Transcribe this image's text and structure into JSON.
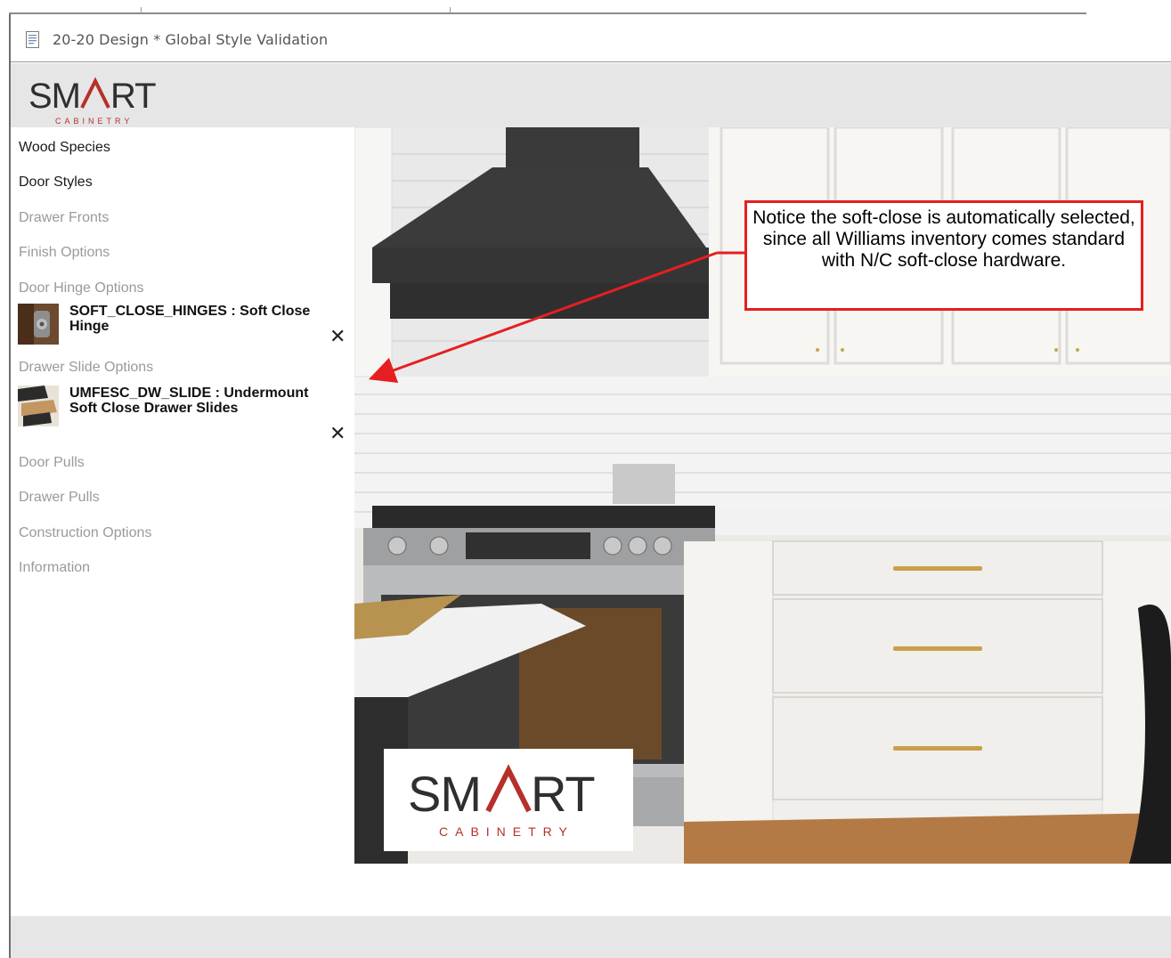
{
  "window": {
    "title": "20-20 Design * Global Style Validation"
  },
  "brand": {
    "logo_word": "SMART",
    "logo_sub": "CABINETRY",
    "accent_color": "#b5302a"
  },
  "sidebar": {
    "items": [
      {
        "label": "Wood Species",
        "state": "active"
      },
      {
        "label": "Door Styles",
        "state": "active"
      },
      {
        "label": "Drawer Fronts",
        "state": "inactive"
      },
      {
        "label": "Finish Options",
        "state": "inactive"
      },
      {
        "label": "Door Hinge Options",
        "state": "inactive"
      },
      {
        "label": "Drawer Slide Options",
        "state": "inactive"
      },
      {
        "label": "Door Pulls",
        "state": "inactive"
      },
      {
        "label": "Drawer Pulls",
        "state": "inactive"
      },
      {
        "label": "Construction Options",
        "state": "inactive"
      },
      {
        "label": "Information",
        "state": "inactive"
      }
    ],
    "selections": [
      {
        "text": "SOFT_CLOSE_HINGES : Soft Close Hinge",
        "remove_icon": "close-icon"
      },
      {
        "text": "UMFESC_DW_SLIDE : Undermount Soft Close Drawer Slides",
        "remove_icon": "close-icon"
      }
    ]
  },
  "callout": {
    "text": "Notice the soft-close is automatically selected, since all Williams inventory comes standard with N/C soft-close hardware.",
    "border_color": "#e51f1f"
  },
  "photo": {
    "overlay_logo_word": "SMART",
    "overlay_logo_sub": "CABINETRY"
  }
}
